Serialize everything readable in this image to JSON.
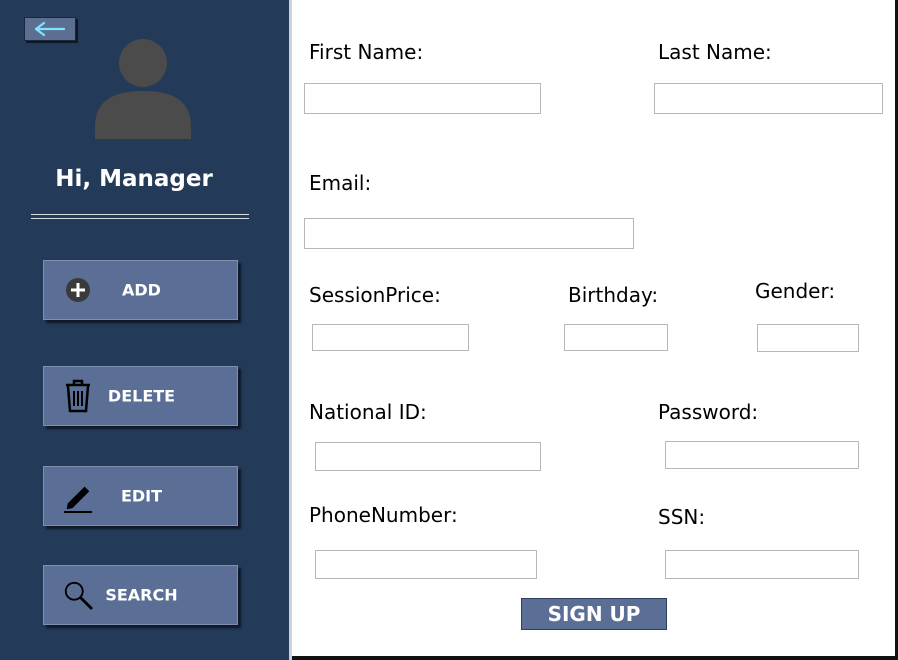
{
  "sidebar": {
    "greeting": "Hi, Manager",
    "buttons": [
      {
        "label": "ADD",
        "icon": "plus-circle-icon"
      },
      {
        "label": "DELETE",
        "icon": "trash-icon"
      },
      {
        "label": "EDIT",
        "icon": "pencil-icon"
      },
      {
        "label": "SEARCH",
        "icon": "search-icon"
      }
    ],
    "back_icon": "arrow-left-icon"
  },
  "form": {
    "first_name": {
      "label": "First Name:",
      "value": ""
    },
    "last_name": {
      "label": "Last Name:",
      "value": ""
    },
    "email": {
      "label": "Email:",
      "value": ""
    },
    "session_price": {
      "label": "SessionPrice:",
      "value": ""
    },
    "birthday": {
      "label": "Birthday:",
      "value": ""
    },
    "gender": {
      "label": "Gender:",
      "value": ""
    },
    "national_id": {
      "label": "National ID:",
      "value": ""
    },
    "password": {
      "label": "Password:",
      "value": ""
    },
    "phone_number": {
      "label": "PhoneNumber:",
      "value": ""
    },
    "ssn": {
      "label": "SSN:",
      "value": ""
    },
    "submit_label": "SIGN UP"
  },
  "colors": {
    "sidebar_bg": "#243a59",
    "button_bg": "#5b6f96",
    "accent_arrow": "#7fe3ff"
  }
}
